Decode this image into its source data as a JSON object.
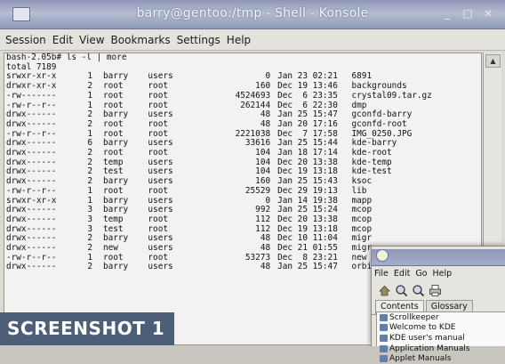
{
  "window": {
    "title": "barry@gentoo:/tmp - Shell - Konsole",
    "controls": [
      "_",
      "□",
      "×"
    ]
  },
  "menubar": [
    "Session",
    "Edit",
    "View",
    "Bookmarks",
    "Settings",
    "Help"
  ],
  "terminal": {
    "prompt_line": "bash-2.05b# ls -l | more",
    "total_line": "total 7189",
    "rows": [
      {
        "perm": "srwxr-xr-x",
        "links": "1",
        "owner": "barry",
        "group": "users",
        "size": "0",
        "date": "Jan 23 02:21",
        "name": "6891"
      },
      {
        "perm": "drwxr-xr-x",
        "links": "2",
        "owner": "root",
        "group": "root",
        "size": "160",
        "date": "Dec 19 13:46",
        "name": "backgrounds"
      },
      {
        "perm": "-rw-------",
        "links": "1",
        "owner": "root",
        "group": "root",
        "size": "4524693",
        "date": "Dec  6 23:35",
        "name": "crystal09.tar.gz"
      },
      {
        "perm": "-rw-r--r--",
        "links": "1",
        "owner": "root",
        "group": "root",
        "size": "262144",
        "date": "Dec  6 22:30",
        "name": "dmp"
      },
      {
        "perm": "drwx------",
        "links": "2",
        "owner": "barry",
        "group": "users",
        "size": "48",
        "date": "Jan 25 15:47",
        "name": "gconfd-barry"
      },
      {
        "perm": "drwx------",
        "links": "2",
        "owner": "root",
        "group": "root",
        "size": "48",
        "date": "Jan 20 17:16",
        "name": "gconfd-root"
      },
      {
        "perm": "-rw-r--r--",
        "links": "1",
        "owner": "root",
        "group": "root",
        "size": "2221038",
        "date": "Dec  7 17:58",
        "name": "IMG_0250.JPG"
      },
      {
        "perm": "drwx------",
        "links": "6",
        "owner": "barry",
        "group": "users",
        "size": "33616",
        "date": "Jan 25 15:44",
        "name": "kde-barry"
      },
      {
        "perm": "drwx------",
        "links": "2",
        "owner": "root",
        "group": "root",
        "size": "104",
        "date": "Jan 18 17:14",
        "name": "kde-root"
      },
      {
        "perm": "drwx------",
        "links": "2",
        "owner": "temp",
        "group": "users",
        "size": "104",
        "date": "Dec 20 13:38",
        "name": "kde-temp"
      },
      {
        "perm": "drwx------",
        "links": "2",
        "owner": "test",
        "group": "users",
        "size": "104",
        "date": "Dec 19 13:18",
        "name": "kde-test"
      },
      {
        "perm": "drwx------",
        "links": "2",
        "owner": "barry",
        "group": "users",
        "size": "160",
        "date": "Jan 25 15:43",
        "name": "ksoc"
      },
      {
        "perm": "-rw-r--r--",
        "links": "1",
        "owner": "root",
        "group": "root",
        "size": "25529",
        "date": "Dec 29 19:13",
        "name": "lib"
      },
      {
        "perm": "srwxr-xr-x",
        "links": "1",
        "owner": "barry",
        "group": "users",
        "size": "0",
        "date": "Jan 14 19:38",
        "name": "mapp"
      },
      {
        "perm": "drwx------",
        "links": "3",
        "owner": "barry",
        "group": "users",
        "size": "992",
        "date": "Jan 25 15:24",
        "name": "mcop"
      },
      {
        "perm": "drwx------",
        "links": "3",
        "owner": "temp",
        "group": "root",
        "size": "112",
        "date": "Dec 20 13:38",
        "name": "mcop"
      },
      {
        "perm": "drwx------",
        "links": "3",
        "owner": "test",
        "group": "root",
        "size": "112",
        "date": "Dec 19 13:18",
        "name": "mcop"
      },
      {
        "perm": "drwx------",
        "links": "2",
        "owner": "barry",
        "group": "users",
        "size": "48",
        "date": "Dec 10 11:04",
        "name": "migr"
      },
      {
        "perm": "drwx------",
        "links": "2",
        "owner": "new",
        "group": "users",
        "size": "48",
        "date": "Dec 21 01:55",
        "name": "migr"
      },
      {
        "perm": "-rw-r--r--",
        "links": "1",
        "owner": "root",
        "group": "root",
        "size": "53273",
        "date": "Dec  8 23:21",
        "name": "new"
      },
      {
        "perm": "drwx------",
        "links": "2",
        "owner": "barry",
        "group": "users",
        "size": "48",
        "date": "Jan 25 15:47",
        "name": "orbi"
      }
    ]
  },
  "help_window": {
    "menu": [
      "File",
      "Edit",
      "Go",
      "Help"
    ],
    "toolbar_icons": [
      "home-icon",
      "back-icon",
      "forward-icon",
      "print-icon"
    ],
    "tabs": [
      "Contents",
      "Glossary"
    ],
    "items": [
      "Scrollkeeper",
      "Welcome to KDE",
      "KDE user's manual",
      "Application Manuals",
      "Applet Manuals"
    ]
  },
  "badge": {
    "text": "SCREENSHOT 1"
  }
}
